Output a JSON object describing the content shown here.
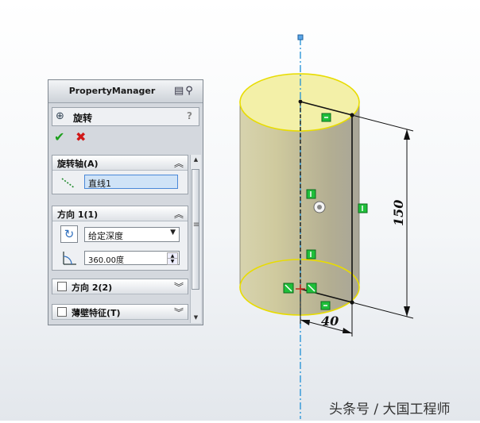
{
  "panel": {
    "title": "PropertyManager",
    "feature": "旋转",
    "help": "?",
    "ok_icon": "check-icon",
    "cancel_icon": "close-icon",
    "groups": [
      {
        "title": "旋转轴(A)",
        "axis_value": "直线1"
      },
      {
        "title": "方向 1(1)",
        "end_condition": "给定深度",
        "angle": "360.00度"
      },
      {
        "title": "方向 2(2)"
      },
      {
        "title": "薄壁特征(T)"
      }
    ]
  },
  "viewport": {
    "dimension_height": "150",
    "dimension_radius": "40"
  },
  "watermark": "头条号 / 大国工程师",
  "colors": {
    "cylinder_body": "#c9c5a0",
    "cylinder_top": "#f2efa6",
    "edge_highlight": "#f0e000",
    "centerline": "#1e8fd6",
    "relation_marker": "#1fbf3a"
  }
}
